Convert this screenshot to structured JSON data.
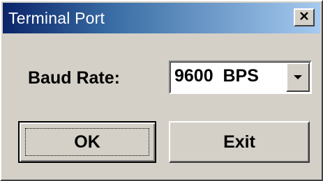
{
  "window": {
    "title": "Terminal Port"
  },
  "icons": {
    "close": "close-icon",
    "dropdown": "chevron-down-icon"
  },
  "form": {
    "baud_label": "Baud Rate:",
    "baud_value": "9600  BPS"
  },
  "buttons": {
    "ok_label": "OK",
    "exit_label": "Exit"
  },
  "colors": {
    "titlebar_start": "#0a246a",
    "titlebar_end": "#a6caf0",
    "face": "#d4d0c8"
  }
}
